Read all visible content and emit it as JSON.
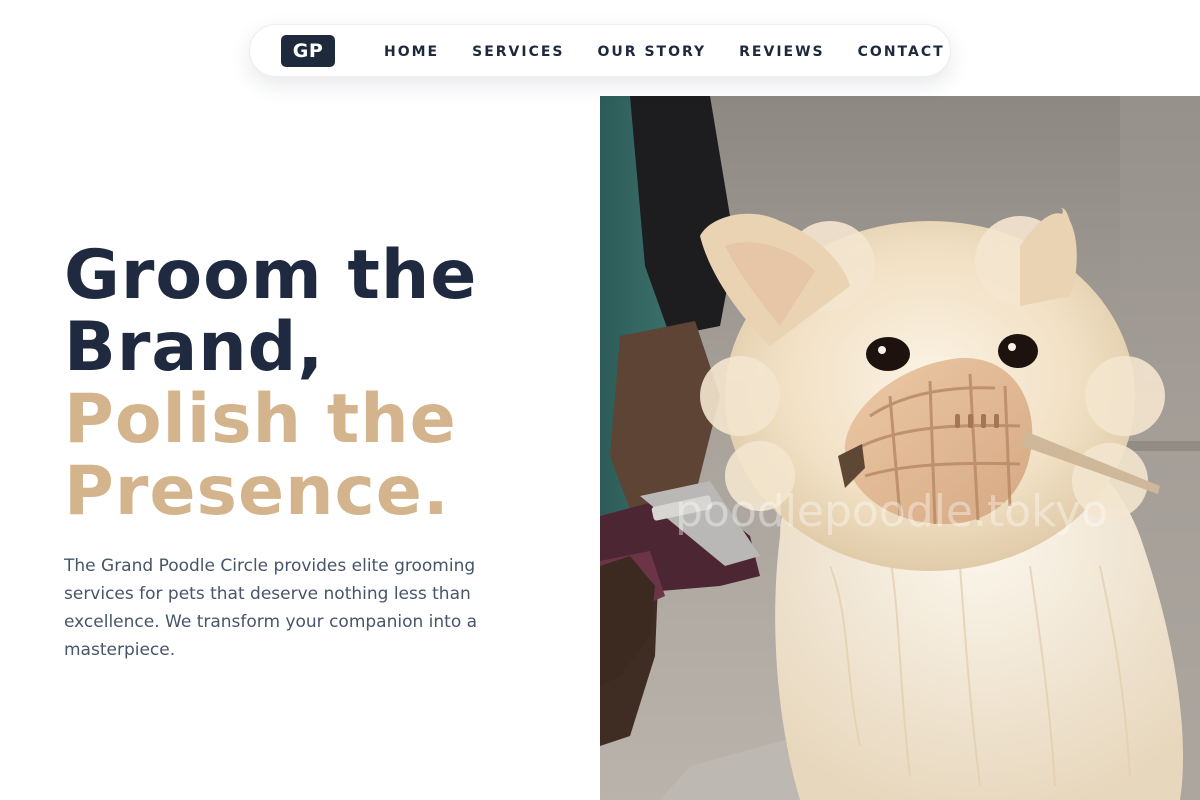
{
  "brand": {
    "logo_text": "GP"
  },
  "nav": {
    "items": [
      {
        "label": "HOME"
      },
      {
        "label": "SERVICES"
      },
      {
        "label": "OUR STORY"
      },
      {
        "label": "REVIEWS"
      },
      {
        "label": "CONTACT"
      }
    ]
  },
  "hero": {
    "title_line_1": "Groom the",
    "title_line_2": "Brand,",
    "title_line_3": "Polish the",
    "title_line_4": "Presence.",
    "description": "The Grand Poodle Circle provides elite grooming services for pets that deserve nothing less than excellence. We transform your companion into a masterpiece.",
    "image": {
      "watermark": "poodlepoodle.tokyo"
    }
  },
  "colors": {
    "navy": "#1f2a40",
    "gold": "#d4b48c",
    "body_text": "#475569"
  }
}
